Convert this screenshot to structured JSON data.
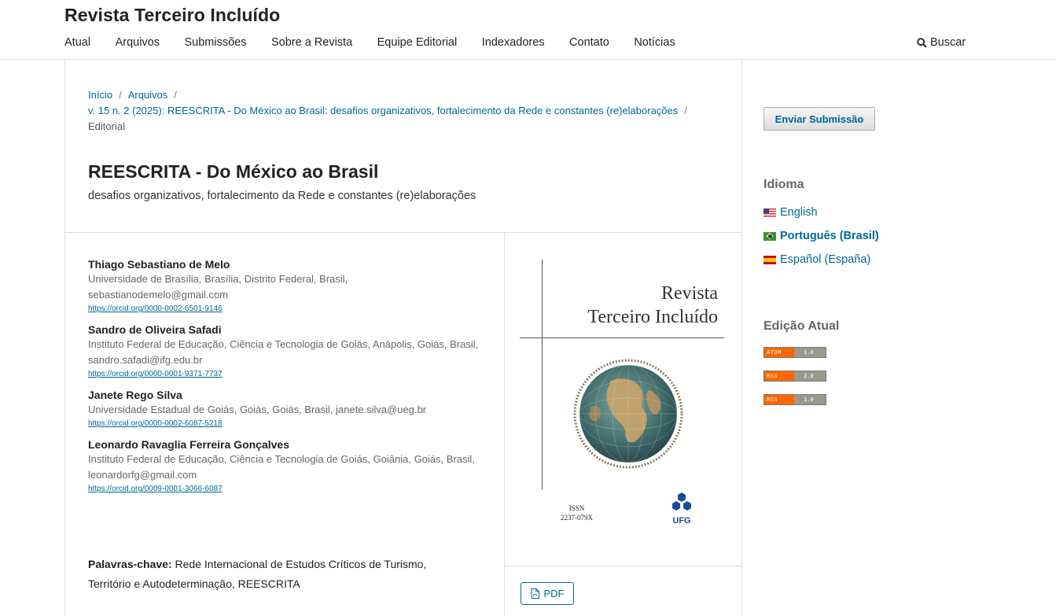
{
  "site": {
    "title": "Revista Terceiro Incluído"
  },
  "nav": {
    "items": [
      "Atual",
      "Arquivos",
      "Submissões",
      "Sobre a Revista",
      "Equipe Editorial",
      "Indexadores",
      "Contato",
      "Notícias"
    ],
    "search_label": "Buscar"
  },
  "breadcrumb": {
    "home": "Início",
    "archives": "Arquivos",
    "issue": "v. 15 n. 2 (2025): REESCRITA - Do México ao Brasil: desafios organizativos, fortalecimento da Rede e constantes (re)elaborações",
    "current": "Editorial",
    "separator": "/"
  },
  "article": {
    "title": "REESCRITA - Do México ao Brasil",
    "subtitle": "desafios organizativos, fortalecimento da Rede e constantes (re)elaborações",
    "authors": [
      {
        "name": "Thiago Sebastiano de Melo",
        "affiliation": "Universidade de Brasília, Brasília, Distrito Federal, Brasil, sebastianodemelo@gmail.com",
        "orcid": "https://orcid.org/0000-0002-6501-9146"
      },
      {
        "name": "Sandro de Oliveira Safadi",
        "affiliation": "Instituto Federal de Educação, Ciência e Tecnologia de Goiás, Anápolis, Goiás, Brasil, sandro.safadi@ifg.edu.br",
        "orcid": "https://orcid.org/0000-0001-9371-7737"
      },
      {
        "name": "Janete Rego Silva",
        "affiliation": "Universidade Estadual de Goiás, Goiás, Goiás, Brasil, janete.silva@ueg.br",
        "orcid": "https://orcid.org/0000-0002-6087-5218"
      },
      {
        "name": "Leonardo Ravaglia Ferreira Gonçalves",
        "affiliation": "Instituto Federal de Educação, Ciência e Tecnologia de Goiás, Goiânia, Goiás, Brasil, leonardorfg@gmail.com",
        "orcid": "https://orcid.org/0009-0001-3066-6087"
      }
    ],
    "keywords_label": "Palavras-chave:",
    "keywords": "Rede Internacional de Estudos Críticos de Turismo, Território e Autodeterminação, REESCRITA"
  },
  "cover": {
    "title_line1": "Revista",
    "title_line2": "Terceiro Incluído",
    "issn_label": "ISSN",
    "issn_value": "2237-079X",
    "logo_label": "UFG"
  },
  "galley": {
    "pdf_label": "PDF"
  },
  "sidebar": {
    "submit_label": "Enviar Submissão",
    "language_heading": "Idioma",
    "languages": [
      {
        "label": "English",
        "flag": "us",
        "current": false
      },
      {
        "label": "Português (Brasil)",
        "flag": "br",
        "current": true
      },
      {
        "label": "Español (España)",
        "flag": "es",
        "current": false
      }
    ],
    "current_issue_heading": "Edição Atual",
    "feeds": [
      {
        "type": "ATOM",
        "version": "1.0"
      },
      {
        "type": "RSS",
        "version": "2.0"
      },
      {
        "type": "RSS",
        "version": "1.0"
      }
    ]
  },
  "colors": {
    "link": "#006798",
    "feed_orange": "#ff6600",
    "feed_gray": "#9a9a8a"
  }
}
